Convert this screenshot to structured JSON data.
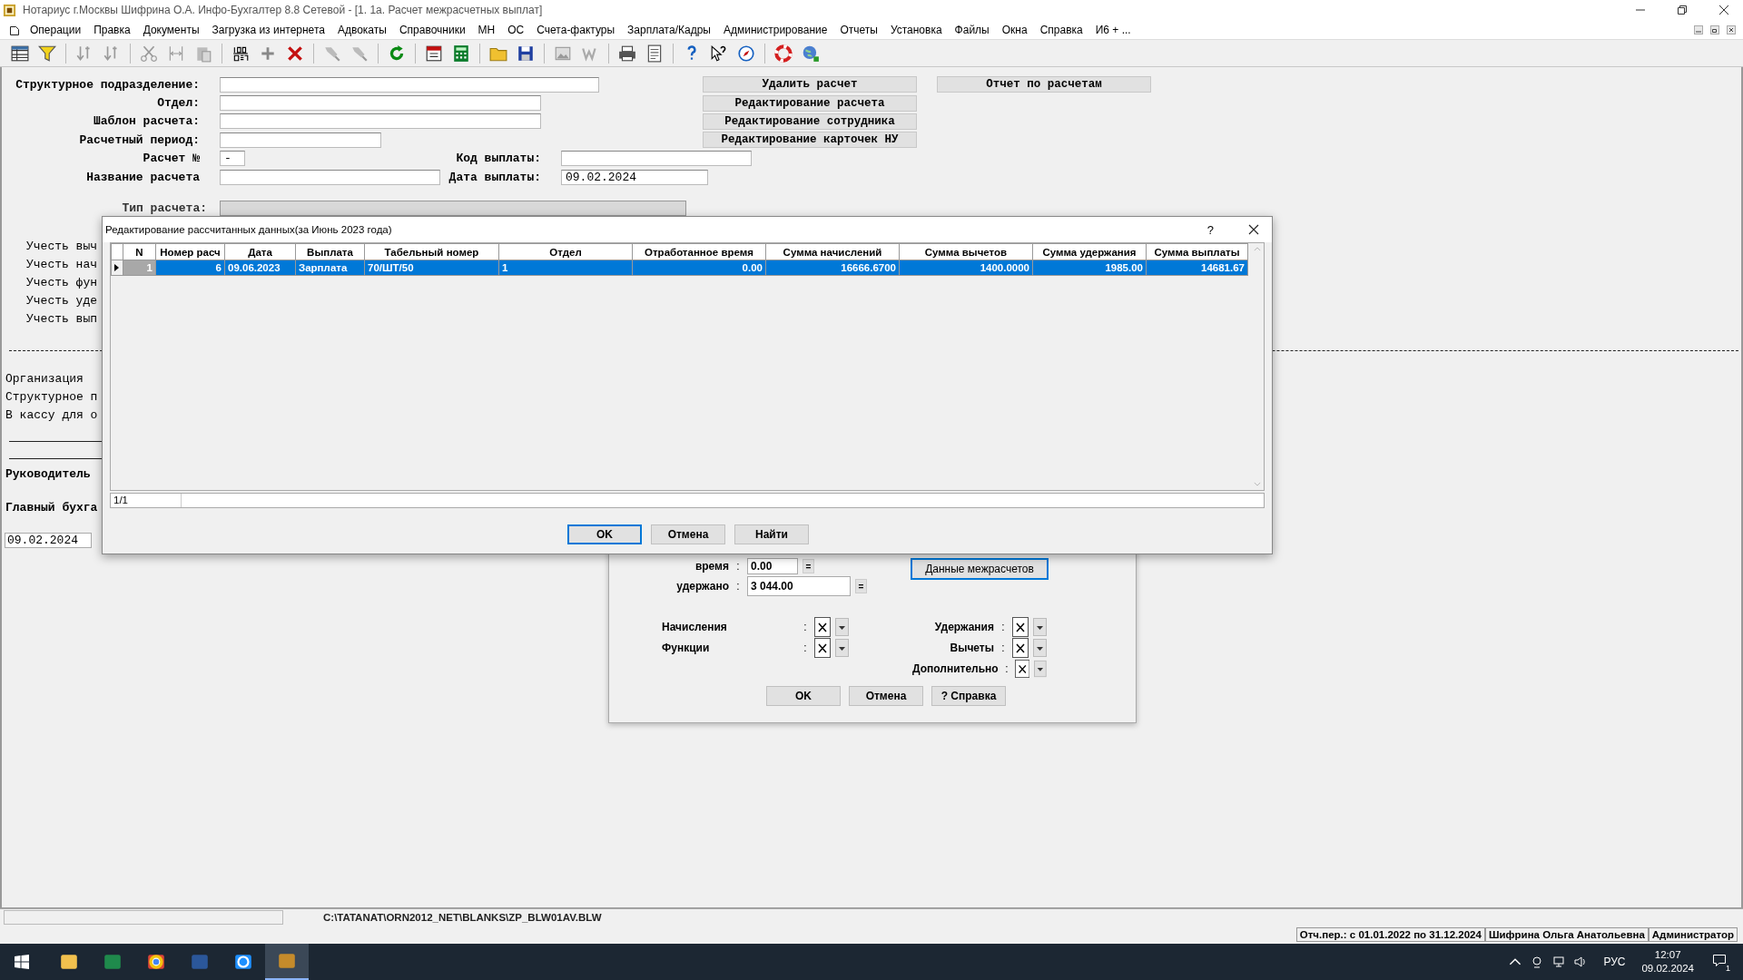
{
  "window": {
    "title": "Нотариус г.Москвы Шифрина О.А. Инфо-Бухгалтер 8.8 Сетевой - [1. 1а. Расчет межрасчетных выплат]"
  },
  "menu": [
    {
      "label": "Операции"
    },
    {
      "label": "Правка"
    },
    {
      "label": "Документы"
    },
    {
      "label": "Загрузка из интернета"
    },
    {
      "label": "Адвокаты"
    },
    {
      "label": "Справочники"
    },
    {
      "label": "МН"
    },
    {
      "label": "ОС"
    },
    {
      "label": "Счета-фактуры"
    },
    {
      "label": "Зарплата/Кадры"
    },
    {
      "label": "Администрирование"
    },
    {
      "label": "Отчеты"
    },
    {
      "label": "Установка"
    },
    {
      "label": "Файлы"
    },
    {
      "label": "Окна"
    },
    {
      "label": "Справка"
    },
    {
      "label": "И6 + ..."
    }
  ],
  "form": {
    "rows": [
      {
        "label": "Структурное подразделение:"
      },
      {
        "label": "Отдел:"
      },
      {
        "label": "Шаблон расчета:"
      },
      {
        "label": "Расчетный период:"
      },
      {
        "label": "Расчет №",
        "value": "-",
        "extra": {
          "label": "Код выплаты:"
        }
      },
      {
        "label": "Название расчета",
        "extra": {
          "label": "Дата выплаты:",
          "value": "09.02.2024"
        }
      }
    ],
    "type_field": {
      "label": "Тип расчета:",
      "disabled": true
    },
    "actions": [
      "Удалить расчет",
      "Редактирование расчета",
      "Редактирование сотрудника",
      "Редактирование карточек НУ"
    ],
    "report_button": "Отчет по расчетам"
  },
  "report_preview": {
    "options": [
      "Учесть выч",
      "Учесть нач",
      "Учесть фун",
      "Учесть уде",
      "Учесть вып"
    ],
    "lines": [
      "Организация",
      "Структурное п",
      "В кассу для о"
    ],
    "signatures": [
      "Руководитель",
      "Главный бухга"
    ],
    "date": "09.02.2024"
  },
  "edit_dialog": {
    "title": "Редактирование рассчитанных данных(за Июнь 2023 года)",
    "help": "?",
    "columns": [
      "N",
      "Номер расч",
      "Дата",
      "Выплата",
      "Табельный номер",
      "Отдел",
      "Отработанное время",
      "Сумма начислений",
      "Сумма вычетов",
      "Сумма удержания",
      "Сумма выплаты"
    ],
    "rows": [
      {
        "selected": true,
        "current": true,
        "cells": [
          "1",
          "6",
          "09.06.2023",
          "Зарплата",
          "70/ШТ/50",
          "1",
          "0.00",
          "16666.6700",
          "1400.0000",
          "1985.00",
          "14681.67"
        ]
      }
    ],
    "status": "1/1",
    "buttons": [
      {
        "label": "OK",
        "default": true
      },
      {
        "label": "Отмена",
        "default": false
      },
      {
        "label": "Найти",
        "default": false
      }
    ]
  },
  "params_dialog": {
    "rows": [
      {
        "label": "время",
        "separator": ":",
        "value": "0.00",
        "calc": "="
      },
      {
        "label": "удержано",
        "separator": ":",
        "value": "3 044.00",
        "calc": "="
      }
    ],
    "side_button": {
      "label": "Данные межрасчетов",
      "focused": true
    },
    "left_checks": [
      {
        "label": "Начисления",
        "separator": ":",
        "checked": true
      },
      {
        "label": "Функции",
        "separator": ":",
        "checked": true
      }
    ],
    "right_checks": [
      {
        "label": "Удержания",
        "separator": ":",
        "checked": true
      },
      {
        "label": "Вычеты",
        "separator": ":",
        "checked": true
      },
      {
        "label": "Дополнительно",
        "separator": ":",
        "checked": true
      }
    ],
    "buttons": [
      "OK",
      "Отмена",
      "? Справка"
    ]
  },
  "status_bar": {
    "path": "C:\\TATANAT\\ORN2012_NET\\BLANKS\\ZP_BLW01AV.BLW",
    "info": [
      "Отч.пер.: с 01.01.2022 по 31.12.2024",
      "Шифрина Ольга Анатольевна",
      "Администратор"
    ]
  },
  "taskbar": {
    "apps": [
      {
        "selected": false
      },
      {
        "selected": false
      },
      {
        "selected": false
      },
      {
        "selected": false
      },
      {
        "selected": false
      },
      {
        "selected": true
      }
    ],
    "language": "РУС",
    "time": "12:07",
    "date": "09.02.2024",
    "notifications": "1"
  }
}
